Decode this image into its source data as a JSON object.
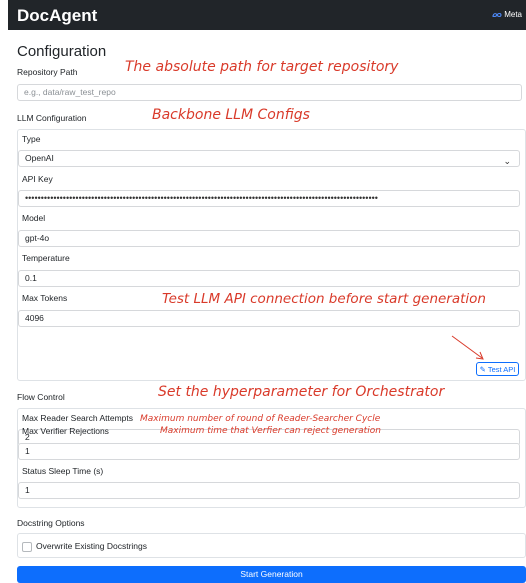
{
  "app": {
    "title": "DocAgent",
    "brand_badge": "Meta"
  },
  "page": {
    "heading": "Configuration"
  },
  "repository": {
    "label": "Repository Path",
    "placeholder": "e.g., data/raw_test_repo"
  },
  "llm": {
    "section_label": "LLM Configuration",
    "type_label": "Type",
    "type_value": "OpenAI",
    "api_key_label": "API Key",
    "api_key_masked": "••••••••••••••••••••••••••••••••••••••••••••••••••••••••••••••••••••••••••••••••••••••••••••••••••••••••••••••••",
    "model_label": "Model",
    "model_value": "gpt-4o",
    "temperature_label": "Temperature",
    "temperature_value": "0.1",
    "max_tokens_label": "Max Tokens",
    "max_tokens_value": "4096",
    "test_button": "Test API"
  },
  "flow": {
    "section_label": "Flow Control",
    "max_reader_label": "Max Reader Search Attempts",
    "max_reader_value": "2",
    "max_verifier_label": "Max Verifier Rejections",
    "max_verifier_value": "1",
    "sleep_label": "Status Sleep Time (s)",
    "sleep_value": "1"
  },
  "docstring": {
    "section_label": "Docstring Options",
    "overwrite_label": "Overwrite Existing Docstrings"
  },
  "start_button": "Start Generation",
  "annotations": {
    "repo": "The absolute path for target repository",
    "llm": "Backbone LLM Configs",
    "test": "Test LLM API connection before start generation",
    "flow": "Set the hyperparameter for Orchestrator",
    "reader": "Maximum number of round of Reader-Searcher Cycle",
    "verifier": "Maximum time that Verfier can reject generation"
  },
  "colors": {
    "accent": "#0d6efd",
    "annotation": "#d93a2a",
    "navbar": "#212529"
  }
}
